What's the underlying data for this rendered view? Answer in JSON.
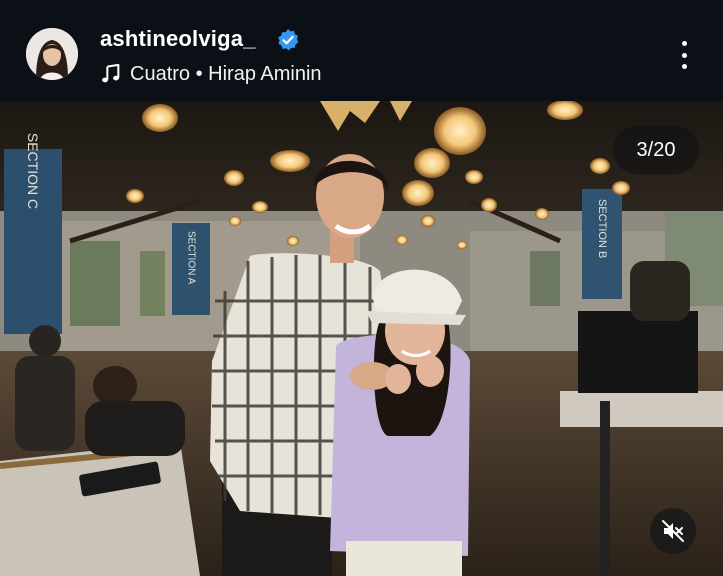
{
  "post": {
    "username": "ashtineolviga_",
    "verified": true,
    "audio": "Cuatro • Hirap Aminin",
    "slide_counter": "3/20"
  },
  "icons": {
    "verified": "verified-badge-icon",
    "music": "music-note-icon",
    "more": "more-options-icon",
    "mute": "speaker-muted-icon"
  },
  "photo": {
    "banner_left": "SECTION C",
    "banner_middle": "SECTION A",
    "banner_right": "SECTION B"
  },
  "colors": {
    "background": "#0b1016",
    "verified": "#3797f0"
  }
}
